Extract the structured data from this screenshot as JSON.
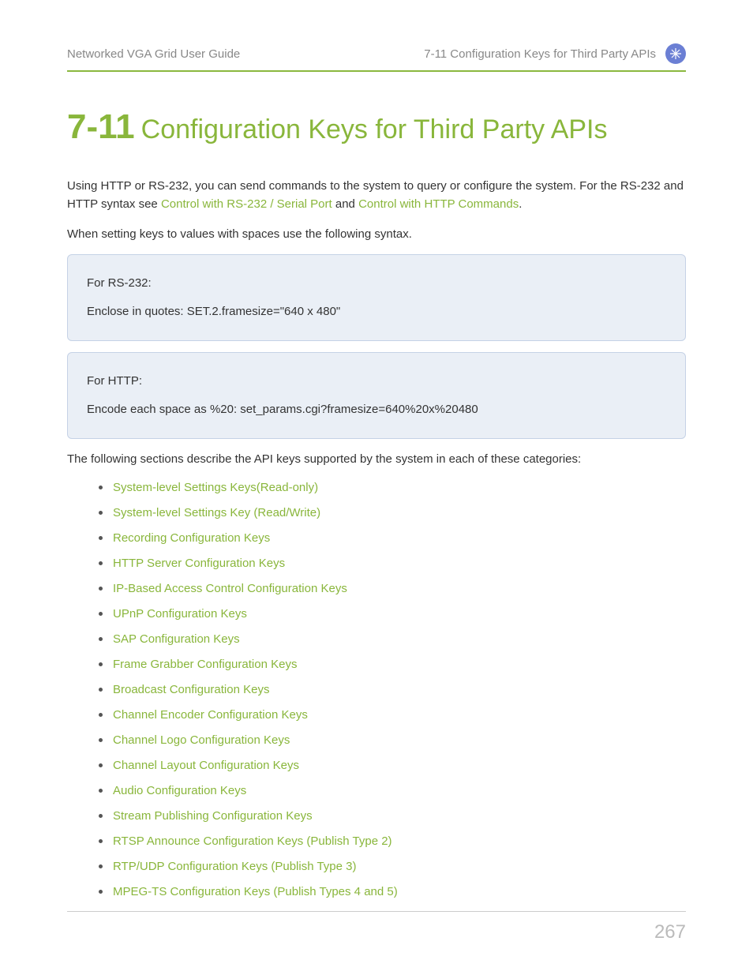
{
  "header": {
    "left": "Networked VGA Grid User Guide",
    "right": "7-11 Configuration Keys for Third Party APIs"
  },
  "title": {
    "section": "7-11",
    "text": "Configuration Keys for Third Party APIs"
  },
  "intro": {
    "p1_a": "Using HTTP or RS-232, you can send commands to the system to query or configure the system. For the RS-232 and HTTP syntax see ",
    "link1": "Control with RS-232 / Serial Port",
    "p1_b": " and ",
    "link2": "Control with HTTP Commands",
    "p1_c": ".",
    "p2": "When setting keys to values with spaces use the following syntax."
  },
  "box1": {
    "line1": "For RS-232:",
    "line2": "Enclose in quotes: SET.2.framesize=\"640 x 480\""
  },
  "box2": {
    "line1": "For HTTP:",
    "line2": "Encode each space as %20: set_params.cgi?framesize=640%20x%20480"
  },
  "p3": "The following sections describe the API keys supported by the system in each of these categories:",
  "links": [
    "System-level Settings Keys(Read-only)",
    "System-level Settings Key (Read/Write)",
    "Recording Configuration Keys",
    "HTTP Server Configuration Keys",
    "IP-Based Access Control Configuration Keys",
    "UPnP Configuration Keys",
    "SAP Configuration Keys",
    "Frame Grabber Configuration Keys",
    "Broadcast Configuration Keys",
    "Channel Encoder Configuration Keys",
    "Channel Logo Configuration Keys",
    "Channel Layout Configuration Keys",
    "Audio Configuration Keys",
    "Stream Publishing Configuration Keys",
    "RTSP Announce Configuration Keys (Publish Type 2)",
    "RTP/UDP Configuration Keys (Publish Type 3)",
    "MPEG-TS Configuration Keys (Publish Types 4 and 5)"
  ],
  "pageNumber": "267"
}
